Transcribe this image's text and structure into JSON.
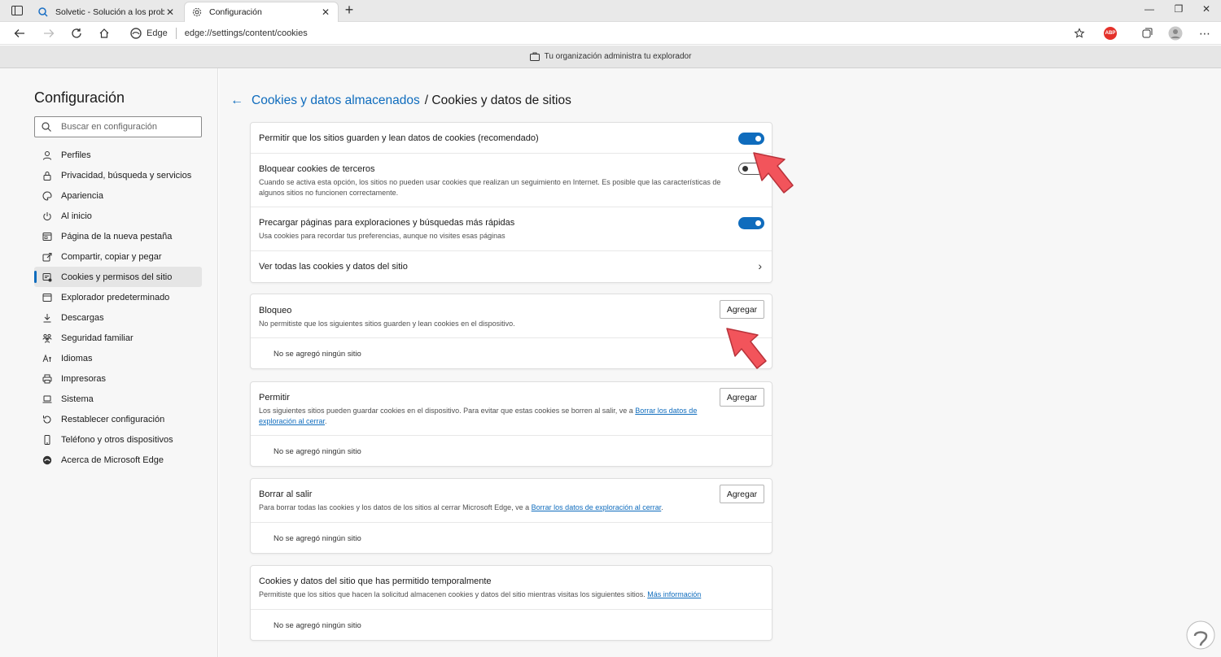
{
  "browser": {
    "tabs": [
      {
        "title": "Solvetic - Solución a los problem",
        "active": false
      },
      {
        "title": "Configuración",
        "active": true
      }
    ],
    "address": {
      "brand": "Edge",
      "url": "edge://settings/content/cookies"
    },
    "infobar": "Tu organización administra tu explorador",
    "abp_label": "ABP"
  },
  "sidebar": {
    "title": "Configuración",
    "search_placeholder": "Buscar en configuración",
    "items": [
      {
        "label": "Perfiles",
        "icon": "profile-icon"
      },
      {
        "label": "Privacidad, búsqueda y servicios",
        "icon": "lock-icon"
      },
      {
        "label": "Apariencia",
        "icon": "palette-icon"
      },
      {
        "label": "Al inicio",
        "icon": "power-icon"
      },
      {
        "label": "Página de la nueva pestaña",
        "icon": "newtab-icon"
      },
      {
        "label": "Compartir, copiar y pegar",
        "icon": "share-icon"
      },
      {
        "label": "Cookies y permisos del sitio",
        "icon": "cookie-permissions-icon",
        "active": true
      },
      {
        "label": "Explorador predeterminado",
        "icon": "browser-icon"
      },
      {
        "label": "Descargas",
        "icon": "download-icon"
      },
      {
        "label": "Seguridad familiar",
        "icon": "family-icon"
      },
      {
        "label": "Idiomas",
        "icon": "language-icon"
      },
      {
        "label": "Impresoras",
        "icon": "printer-icon"
      },
      {
        "label": "Sistema",
        "icon": "laptop-icon"
      },
      {
        "label": "Restablecer configuración",
        "icon": "reset-icon"
      },
      {
        "label": "Teléfono y otros dispositivos",
        "icon": "phone-icon"
      },
      {
        "label": "Acerca de Microsoft Edge",
        "icon": "edge-logo-icon"
      }
    ]
  },
  "main": {
    "breadcrumb_parent": "Cookies y datos almacenados",
    "breadcrumb_current": "/ Cookies y datos de sitios",
    "settings": {
      "allow": {
        "title": "Permitir que los sitios guarden y lean datos de cookies (recomendado)",
        "on": true
      },
      "block_third": {
        "title": "Bloquear cookies de terceros",
        "desc": "Cuando se activa esta opción, los sitios no pueden usar cookies que realizan un seguimiento en Internet. Es posible que las características de algunos sitios no funcionen correctamente.",
        "on": false
      },
      "preload": {
        "title": "Precargar páginas para exploraciones y búsquedas más rápidas",
        "desc": "Usa cookies para recordar tus preferencias, aunque no visites esas páginas",
        "on": true
      },
      "see_all": {
        "title": "Ver todas las cookies y datos del sitio"
      }
    },
    "block": {
      "title": "Bloqueo",
      "desc": "No permitiste que los siguientes sitios guarden y lean cookies en el dispositivo.",
      "button": "Agregar",
      "empty": "No se agregó ningún sitio"
    },
    "allow": {
      "title": "Permitir",
      "desc": "Los siguientes sitios pueden guardar cookies en el dispositivo. Para evitar que estas cookies se borren al salir, ve a",
      "link": "Borrar los datos de exploración al cerrar",
      "desc_end": ".",
      "button": "Agregar",
      "empty": "No se agregó ningún sitio"
    },
    "clear": {
      "title": "Borrar al salir",
      "desc": "Para borrar todas las cookies y los datos de los sitios al cerrar Microsoft Edge, ve a",
      "link": "Borrar los datos de exploración al cerrar",
      "desc_end": ".",
      "button": "Agregar",
      "empty": "No se agregó ningún sitio"
    },
    "temp": {
      "title": "Cookies y datos del sitio que has permitido temporalmente",
      "desc": "Permitiste que los sitios que hacen la solicitud almacenen cookies y datos del sitio mientras visitas los siguientes sitios.",
      "link": "Más información",
      "empty": "No se agregó ningún sitio"
    }
  },
  "colors": {
    "accent": "#0f6cbd",
    "annotation_arrow": "#f2545b"
  }
}
